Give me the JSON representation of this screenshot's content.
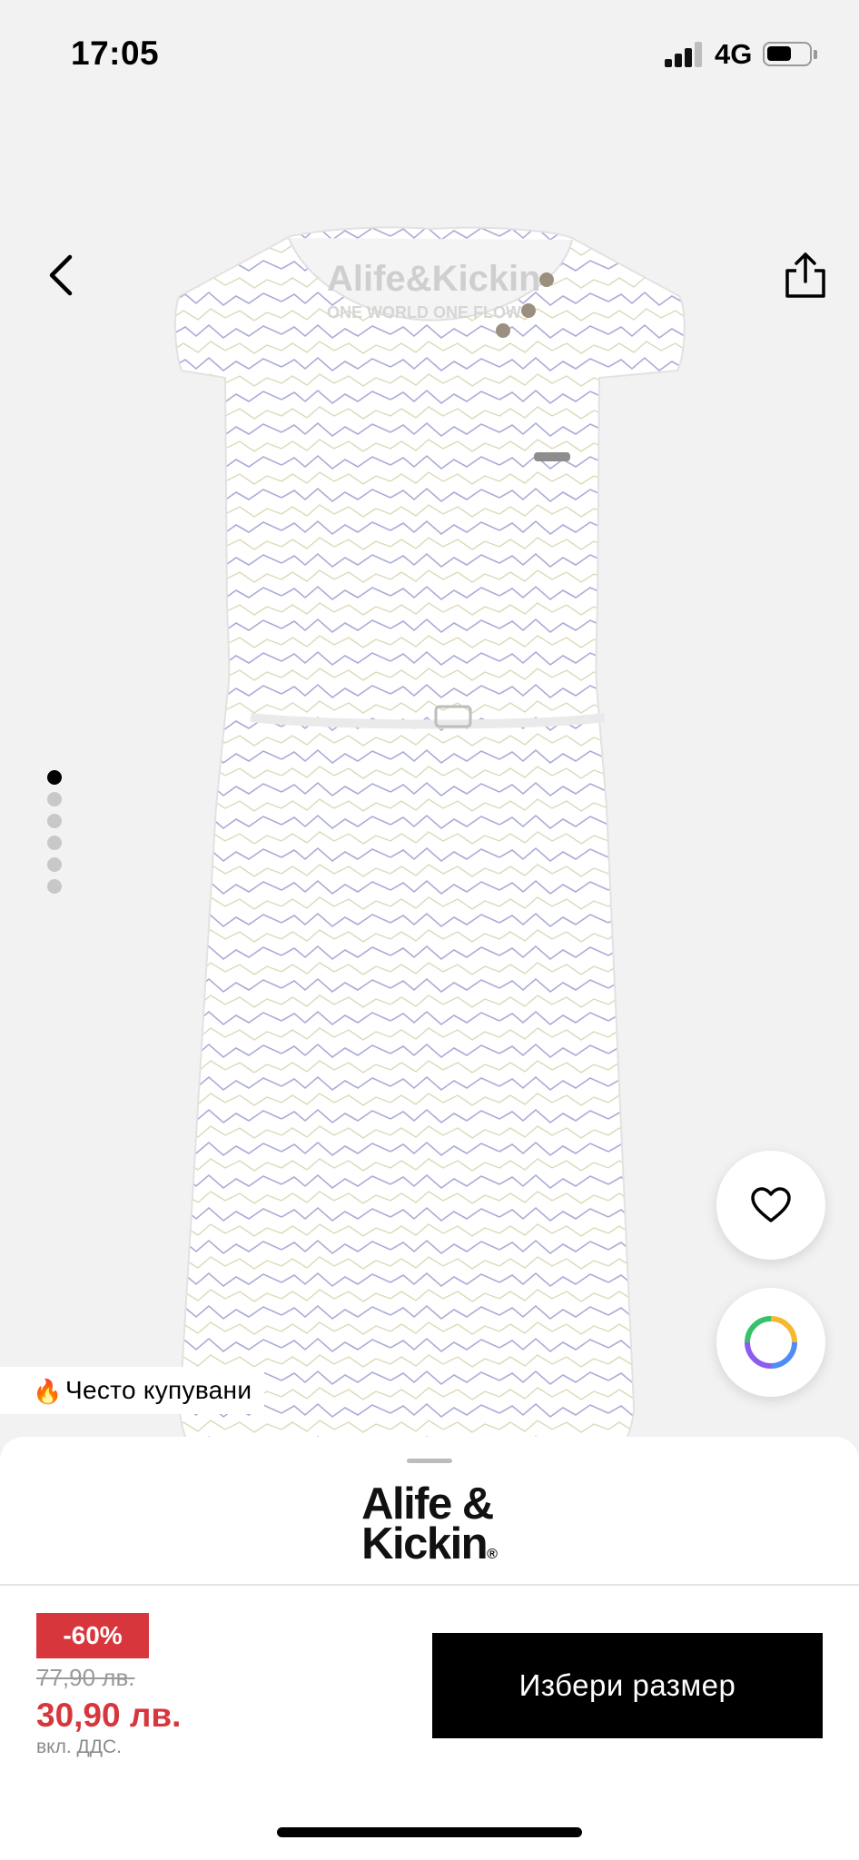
{
  "status_bar": {
    "time": "17:05",
    "network": "4G"
  },
  "gallery": {
    "back_icon": "chevron-left-icon",
    "share_icon": "share-icon",
    "image_count": 6,
    "active_index": 0,
    "image_logo_line1": "Alife&Kickin",
    "image_logo_line2": "ONE WORLD ONE FLOW"
  },
  "badge": {
    "icon": "fire-icon",
    "text": "Често купувани"
  },
  "actions": {
    "favorite_icon": "heart-icon",
    "colors_icon": "color-wheel-icon"
  },
  "product": {
    "brand_line1": "Alife &",
    "brand_line2": "Kickin",
    "brand_mark": "®",
    "discount": "-60%",
    "old_price": "77,90 лв.",
    "new_price": "30,90 лв.",
    "vat_note": "вкл. ДДС.",
    "cta_label": "Избери размер"
  },
  "colors": {
    "sale_red": "#d7373c",
    "cta_bg": "#000000",
    "page_bg": "#f2f2f2"
  }
}
